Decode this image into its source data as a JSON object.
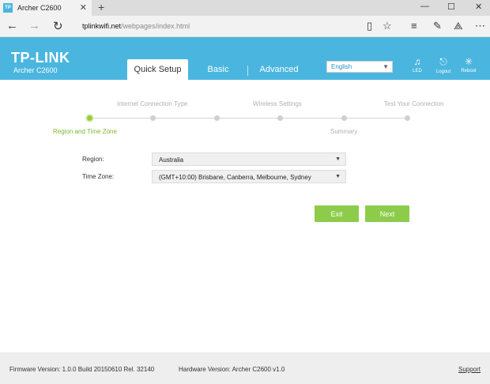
{
  "browser": {
    "tab_title": "Archer C2600",
    "favicon_text": "TP",
    "url_host": "tplinkwifi.net",
    "url_path": "/webpages/index.html"
  },
  "header": {
    "brand": "TP-LINK",
    "model": "Archer C2600",
    "tabs": [
      "Quick Setup",
      "Basic",
      "Advanced"
    ],
    "active_tab": "Quick Setup",
    "language": "English",
    "icons": [
      {
        "name": "led-icon",
        "label": "LED"
      },
      {
        "name": "logout-icon",
        "label": "Logout"
      },
      {
        "name": "reboot-icon",
        "label": "Reboot"
      }
    ],
    "accent_color": "#4ab6df"
  },
  "progress": {
    "steps_top": [
      "Internet Connection Type",
      "Wireless Settings",
      "Test Your Connection"
    ],
    "steps_bottom": [
      "Region and Time Zone",
      "Summary"
    ],
    "current_step": "Region and Time Zone",
    "active_color": "#9acb3e"
  },
  "form": {
    "region_label": "Region:",
    "region_value": "Australia",
    "timezone_label": "Time Zone:",
    "timezone_value": "(GMT+10:00) Brisbane, Canberra, Melbourne, Sydney"
  },
  "buttons": {
    "exit": "Exit",
    "next": "Next",
    "color": "#8dcc4a"
  },
  "footer": {
    "firmware": "Firmware Version: 1.0.0 Build 20150610 Rel. 32140",
    "hardware": "Hardware Version: Archer C2600 v1.0",
    "support": "Support"
  }
}
